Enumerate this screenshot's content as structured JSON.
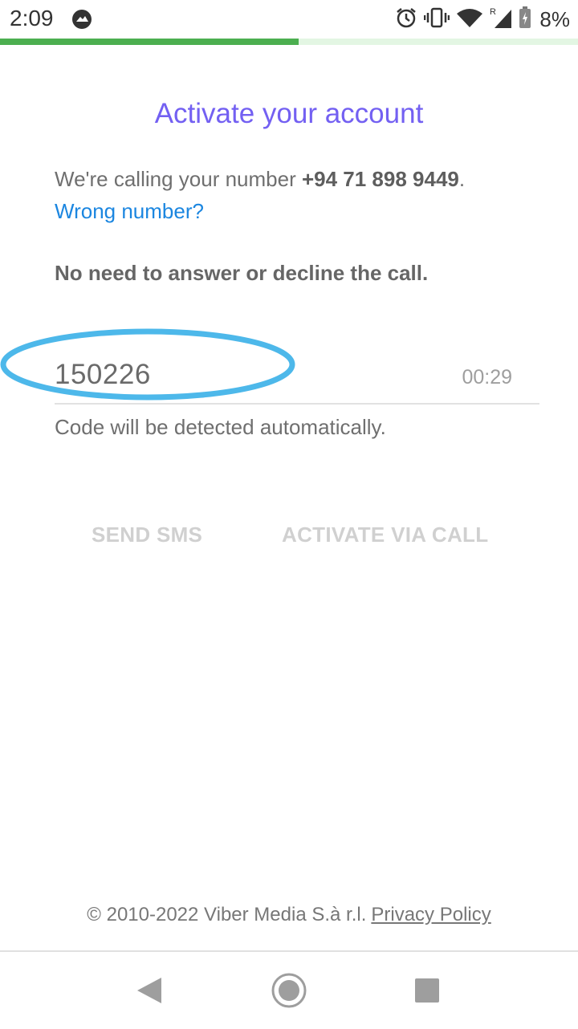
{
  "status_bar": {
    "time": "2:09",
    "battery": "8%",
    "icons": [
      "app-notification-icon",
      "alarm-icon",
      "vibrate-icon",
      "wifi-icon",
      "roaming-signal-icon",
      "battery-icon"
    ]
  },
  "progress": {
    "fraction": 0.517,
    "fill_color": "#4caf50",
    "track_color": "#e3f6e3"
  },
  "activate": {
    "title": "Activate your account",
    "calling_prefix": "We're calling your number ",
    "phone_number": "+94 71 898 9449",
    "calling_suffix": ".",
    "wrong_number_link": "Wrong number?",
    "no_need_note": "No need to answer or decline the call.",
    "code": "150226",
    "timer": "00:29",
    "auto_detect_note": "Code will be detected automatically.",
    "send_sms_button": "SEND SMS",
    "activate_call_button": "ACTIVATE VIA CALL"
  },
  "footer": {
    "copyright": "© 2010-2022 Viber Media S.à r.l.",
    "privacy_link": "Privacy Policy"
  },
  "nav": {
    "back": "back-icon",
    "home": "home-icon",
    "recents": "recents-icon"
  },
  "colors": {
    "accent": "#7360f2",
    "link": "#1b86e0",
    "highlight": "#4db8ea"
  }
}
